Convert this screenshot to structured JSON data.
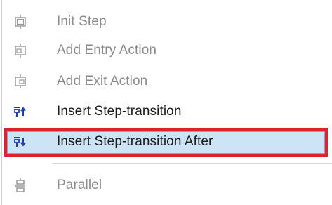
{
  "menu": {
    "items": [
      {
        "label": "Init Step",
        "enabled": false,
        "icon": "init-step-icon"
      },
      {
        "label": "Add Entry Action",
        "enabled": false,
        "icon": "add-entry-action-icon"
      },
      {
        "label": "Add Exit Action",
        "enabled": false,
        "icon": "add-exit-action-icon"
      },
      {
        "label": "Insert Step-transition",
        "enabled": true,
        "icon": "insert-step-transition-before-icon"
      },
      {
        "label": "Insert Step-transition After",
        "enabled": true,
        "selected": true,
        "icon": "insert-step-transition-after-icon"
      },
      {
        "label": "Parallel",
        "enabled": false,
        "icon": "parallel-icon"
      }
    ]
  },
  "colors": {
    "highlight_fill": "#cde4f7",
    "highlight_border": "#e0202c",
    "disabled_text": "#8a8a8a",
    "enabled_text": "#1a1a1a",
    "icon_blue": "#1d3fb0",
    "icon_gray": "#9a9a9a"
  }
}
